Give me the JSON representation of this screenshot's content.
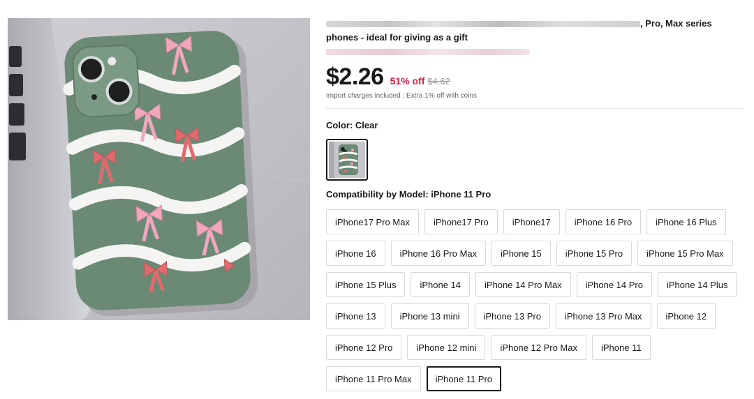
{
  "product": {
    "title_visible": ", Pro, Max series",
    "title_line2": "phones - ideal for giving as a gift",
    "price": "$2.26",
    "discount": "51% off",
    "original_price": "$4.62",
    "charges_note": "Import charges included ; Extra 1% off with coins"
  },
  "color": {
    "label": "Color: Clear",
    "selected_swatch": "clear-bow-case"
  },
  "compatibility": {
    "label": "Compatibility by Model: iPhone 11 Pro",
    "selected": "iPhone 11 Pro",
    "models": [
      "iPhone17 Pro Max",
      "iPhone17 Pro",
      "iPhone17",
      "iPhone 16 Pro",
      "iPhone 16 Plus",
      "iPhone 16",
      "iPhone 16 Pro Max",
      "iPhone 15",
      "iPhone 15 Pro",
      "iPhone 15 Pro Max",
      "iPhone 15 Plus",
      "iPhone 14",
      "iPhone 14 Pro Max",
      "iPhone 14 Pro",
      "iPhone 14 Plus",
      "iPhone 13",
      "iPhone 13 mini",
      "iPhone 13 Pro",
      "iPhone 13 Pro Max",
      "iPhone 12",
      "iPhone 12 Pro",
      "iPhone 12 mini",
      "iPhone 12 Pro Max",
      "iPhone 11",
      "iPhone 11 Pro Max",
      "iPhone 11 Pro"
    ]
  },
  "colors": {
    "discount": "#e3173e",
    "case_green": "#6b8a76",
    "bow_pink": "#f1a7bd",
    "bow_red": "#e06a6e"
  }
}
